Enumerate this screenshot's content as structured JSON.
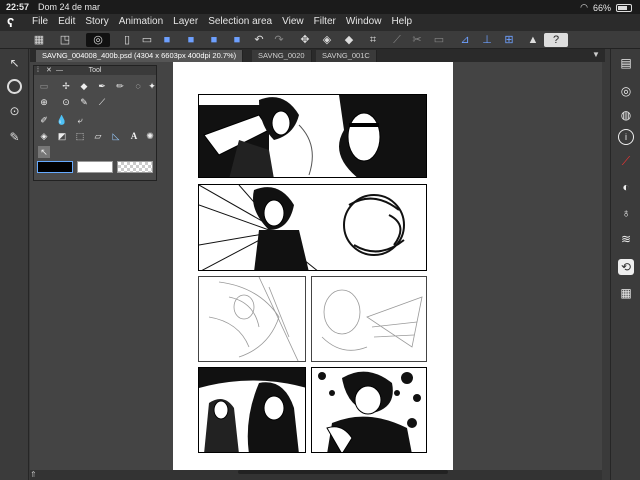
{
  "status": {
    "time": "22:57",
    "date": "Dom 24 de mar",
    "battery": "66%"
  },
  "menu": [
    "File",
    "Edit",
    "Story",
    "Animation",
    "Layer",
    "Selection area",
    "View",
    "Filter",
    "Window",
    "Help"
  ],
  "tabs": [
    {
      "label": "SAVNG_004008_400b.psd (4304 x 6603px 400dpi 20.7%)",
      "active": true
    },
    {
      "label": "SAVNG_0020",
      "active": false
    },
    {
      "label": "SAVNG_001C",
      "active": false
    }
  ],
  "tool_palette": {
    "title": "Tool"
  },
  "icons": {
    "toolbar": [
      "grid-icon",
      "view-icon",
      "lasso-icon",
      "new-file-icon",
      "open-icon",
      "save-icon",
      "save-as-icon",
      "export-icon",
      "undo-icon",
      "redo-icon",
      "transform-icon",
      "fill-icon",
      "eraser-icon",
      "crop-icon",
      "ruler-icon",
      "cut-icon",
      "clear-icon",
      "mark-icon",
      "snap-ruler-icon",
      "snap-special-icon",
      "snap-grid-icon",
      "learn-icon",
      "help-icon"
    ],
    "left": [
      "pen-selector-icon",
      "zoom-icon",
      "color-picker-icon",
      "brush-size-icon"
    ],
    "right": [
      "navigator-icon",
      "sub-tool-icon",
      "layer-icon",
      "info-icon",
      "color-wheel-icon",
      "material-icon",
      "brush-icon",
      "history-icon",
      "search-icon",
      "timeline-icon"
    ]
  },
  "colors": {
    "menubar": "#2b2b2b",
    "workspace": "#444444",
    "page": "#ffffff"
  }
}
